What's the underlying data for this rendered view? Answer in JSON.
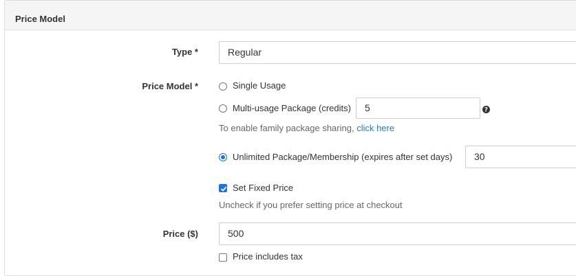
{
  "panel": {
    "title": "Price Model"
  },
  "type_field": {
    "label": "Type *",
    "value": "Regular"
  },
  "price_model": {
    "label": "Price Model *",
    "options": [
      {
        "label": "Single Usage",
        "checked": false
      },
      {
        "label": "Multi-usage Package (credits)",
        "checked": false,
        "value": "5"
      },
      {
        "label": "Unlimited Package/Membership (expires after set days)",
        "checked": true,
        "value": "30"
      }
    ],
    "family_note": "To enable family package sharing,",
    "family_link": "click here",
    "help_icon": "question-circle-icon"
  },
  "fixed_price": {
    "label": "Set Fixed Price",
    "checked": true,
    "note": "Uncheck if you prefer setting price at checkout"
  },
  "price_field": {
    "label": "Price ($)",
    "value": "500"
  },
  "tax": {
    "label": "Price includes tax",
    "checked": false
  },
  "colors": {
    "accent": "#1a73e8",
    "link": "#2a7ab8",
    "header_bg": "#f5f5f5",
    "border": "#dddddd"
  }
}
